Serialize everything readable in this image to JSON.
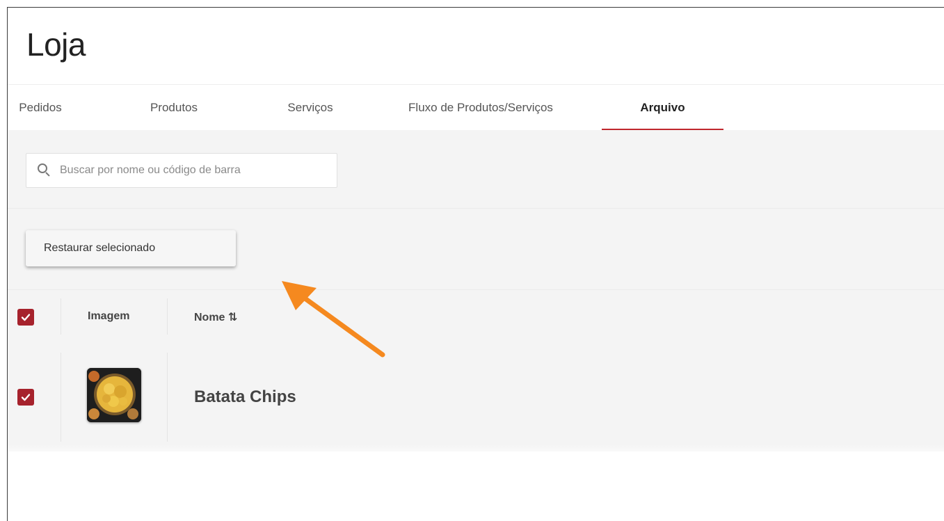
{
  "page": {
    "title": "Loja"
  },
  "tabs": [
    {
      "label": "Pedidos",
      "active": false
    },
    {
      "label": "Produtos",
      "active": false
    },
    {
      "label": "Serviços",
      "active": false
    },
    {
      "label": "Fluxo de Produtos/Serviços",
      "active": false
    },
    {
      "label": "Arquivo",
      "active": true
    }
  ],
  "search": {
    "placeholder": "Buscar por nome ou código de barra",
    "value": ""
  },
  "actions": {
    "restore_label": "Restaurar selecionado"
  },
  "table": {
    "columns": {
      "image": "Imagem",
      "name": "Nome ⇅"
    },
    "select_all_checked": true,
    "rows": [
      {
        "name": "Batata Chips",
        "checked": true,
        "image_icon": "chips-bowl-thumbnail"
      }
    ]
  },
  "colors": {
    "accent": "#c0262d",
    "checkbox": "#a6222c",
    "annotation_arrow": "#f5891f"
  },
  "annotation": {
    "icon": "orange-arrow-pointer"
  }
}
